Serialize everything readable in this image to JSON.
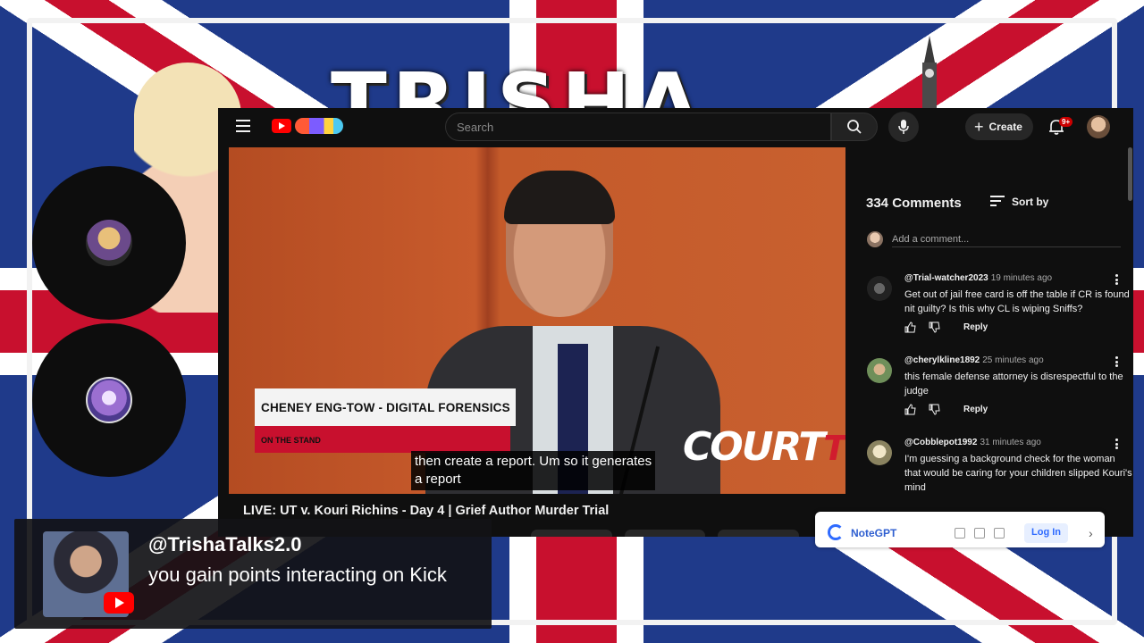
{
  "brand": {
    "title": "TRISHA"
  },
  "youtube": {
    "search": {
      "placeholder": "Search"
    },
    "create_label": "Create",
    "notifications_badge": "9+",
    "video": {
      "lower_third_name": "CHENEY ENG-TOW - DIGITAL FORENSICS",
      "lower_third_tag": "ON THE STAND",
      "caption_line1": "then create a report. Um so it generates",
      "caption_line2": "a report",
      "network_logo": "COURT",
      "network_logo_suffix": "TV"
    },
    "video_title": "LIVE: UT v. Kouri Richins - Day 4 | Grief Author Murder Trial",
    "comments": {
      "count_label": "334 Comments",
      "sort_label": "Sort by",
      "add_placeholder": "Add a comment...",
      "reply_label": "Reply",
      "items": [
        {
          "handle": "@Trial-watcher2023",
          "time": "19 minutes ago",
          "text": "Get out of jail free card is off the table if CR is found nit guilty? Is this why CL is wiping Sniffs?"
        },
        {
          "handle": "@cherylkline1892",
          "time": "25 minutes ago",
          "text": "this female defense attorney is disrespectful to the judge"
        },
        {
          "handle": "@Cobblepot1992",
          "time": "31 minutes ago",
          "text": "I'm guessing a background check for the woman that would be caring for your children slipped Kouri's mind"
        }
      ]
    },
    "extension": {
      "name": "NoteGPT",
      "login_label": "Log In"
    }
  },
  "chat_overlay": {
    "username": "@TrishaTalks2.0",
    "message": "you gain points interacting on Kick"
  },
  "colors": {
    "accent_red": "#c8102e",
    "youtube_red": "#ff0000",
    "panel_bg": "#0f0f0f"
  }
}
